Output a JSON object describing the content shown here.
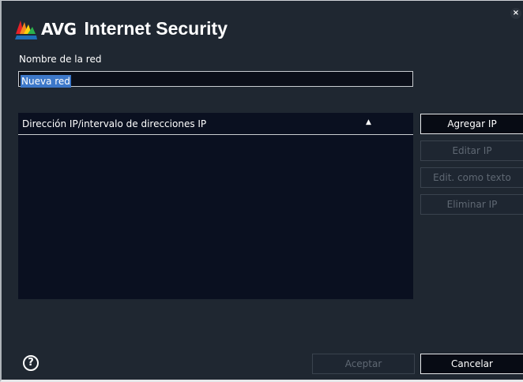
{
  "window": {
    "brand": "AVG",
    "product": "Internet Security",
    "close_glyph": "×",
    "logo_icon": "avg-logo-icon",
    "close_icon": "close-icon"
  },
  "network_name": {
    "label": "Nombre de la red",
    "value": "Nueva red"
  },
  "ip_list": {
    "column_header": "Dirección IP/intervalo de direcciones IP",
    "sort_indicator": "▲",
    "rows": []
  },
  "buttons": {
    "add_ip": "Agregar IP",
    "edit_ip": "Editar IP",
    "edit_as_text": "Edit. como texto",
    "delete_ip": "Eliminar IP",
    "accept": "Aceptar",
    "cancel": "Cancelar"
  },
  "help": {
    "glyph": "?",
    "icon": "help-icon"
  },
  "colors": {
    "dialog_bg": "#1f2731",
    "list_bg": "#0a1020",
    "selection": "#3d78c9",
    "disabled_text": "#5f6873"
  }
}
